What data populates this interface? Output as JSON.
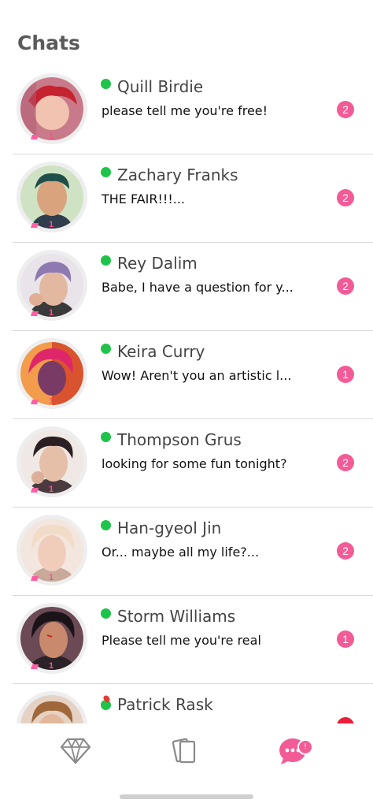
{
  "header": {
    "title": "Chats"
  },
  "chats": [
    {
      "name": "Quill Birdie",
      "preview": "please tell me you're free!",
      "unread": "2",
      "level": "1",
      "status": "online"
    },
    {
      "name": "Zachary Franks",
      "preview": "THE FAIR!!!...",
      "unread": "2",
      "level": "1",
      "status": "online"
    },
    {
      "name": "Rey Dalim",
      "preview": "Babe, I have a question for y...",
      "unread": "2",
      "level": "1",
      "status": "online"
    },
    {
      "name": "Keira Curry",
      "preview": "Wow! Aren't you an artistic l...",
      "unread": "1",
      "level": "1",
      "status": "online"
    },
    {
      "name": "Thompson Grus",
      "preview": "looking for some fun tonight?",
      "unread": "2",
      "level": "1",
      "status": "online"
    },
    {
      "name": "Han-gyeol Jin",
      "preview": "Or... maybe all my life?...",
      "unread": "2",
      "level": "1",
      "status": "online"
    },
    {
      "name": "Storm Williams",
      "preview": "Please tell me you're real",
      "unread": "1",
      "level": "1",
      "status": "online"
    },
    {
      "name": "Patrick Rask",
      "preview": "",
      "unread": "",
      "level": "",
      "status": "online"
    }
  ],
  "nav": {
    "items": [
      {
        "icon": "diamond-icon"
      },
      {
        "icon": "cards-icon"
      },
      {
        "icon": "chat-bubble-icon",
        "badge": "!"
      }
    ]
  },
  "colors": {
    "accent": "#f35b96",
    "online": "#1ec44a"
  }
}
